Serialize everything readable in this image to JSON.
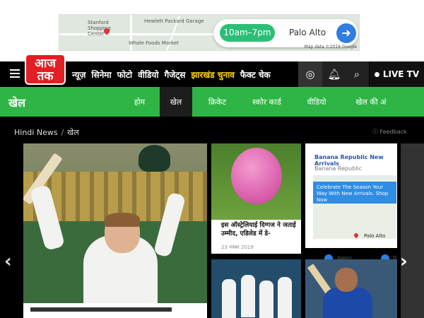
{
  "ad": {
    "map_labels": [
      "Stanford Shopping Center",
      "Hewlett Packard Garage",
      "Whole Foods Market",
      "Palo Alto"
    ],
    "hours": "10am–7pm",
    "location": "Palo Alto",
    "copyright": "Map data ©2019 Google"
  },
  "header": {
    "logo": "आज तक",
    "nav": [
      "न्यूज़",
      "सिनेमा",
      "फोटो",
      "वीडियो",
      "गैजेट्स",
      "झारखंड चुनाव",
      "फैक्ट चेक"
    ],
    "nav_highlight_index": 5,
    "live_label": "LIVE TV"
  },
  "subnav": {
    "section": "खेल",
    "tabs": [
      "होम",
      "खेल",
      "क्रिकेट",
      "स्कोर कार्ड",
      "वीडियो",
      "खेल की अं"
    ],
    "active_tab": "खेल"
  },
  "breadcrumb": {
    "home": "Hindi News",
    "separator": "/",
    "current": "खेल"
  },
  "feedback": "Feedback",
  "cards": {
    "pink_ball": {
      "title": "इस ऑस्ट्रेलियाई दिग्गज ने जताई उम्मीद, एडिलेड में डे-",
      "date": "23 नवंबर 2019"
    },
    "ad_card": {
      "title": "Banana Republic New Arrivals",
      "brand": "Banana Republic",
      "bubble": "Celebrate The Season Your Way With New Arrivals. Shop Now",
      "place": "Palo Alto",
      "btn1": "वेबसाइट",
      "btn2": "दि"
    }
  },
  "colors": {
    "brand_red": "#e31e24",
    "section_green": "#2fb545",
    "nav_black": "#000000",
    "highlight_yellow": "#ffd400"
  },
  "icons": [
    "menu-icon",
    "audio-icon",
    "bell-icon",
    "search-icon",
    "live-dot-icon",
    "feedback-icon",
    "chevron-left-icon",
    "chevron-right-icon",
    "directions-icon"
  ]
}
